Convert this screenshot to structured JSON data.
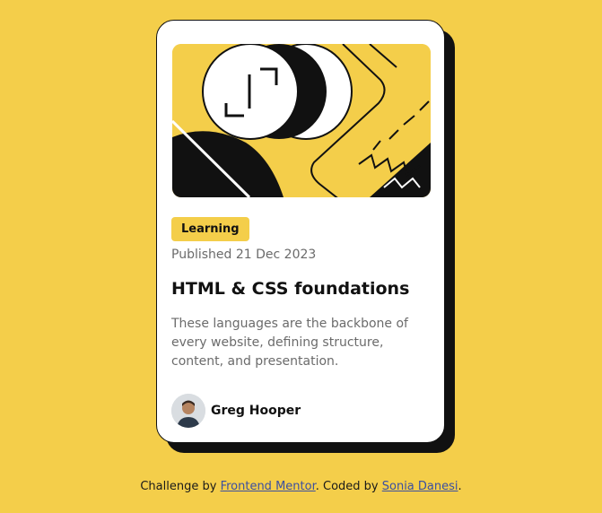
{
  "colors": {
    "background": "#F4CE4A",
    "card": "#FFFFFF",
    "ink": "#111111",
    "muted": "#6b6b6b",
    "link": "#3b4fa0"
  },
  "card": {
    "image_icon": "abstract-illustration",
    "badge": "Learning",
    "published": "Published 21 Dec 2023",
    "title": "HTML & CSS foundations",
    "description": "These languages are the backbone of every website, defining structure, content, and presentation.",
    "author": {
      "avatar_icon": "avatar-photo",
      "name": "Greg Hooper"
    }
  },
  "footer": {
    "prefix": "Challenge by ",
    "link1": "Frontend Mentor",
    "middle": ". Coded by ",
    "link2": "Sonia Danesi",
    "suffix": "."
  }
}
